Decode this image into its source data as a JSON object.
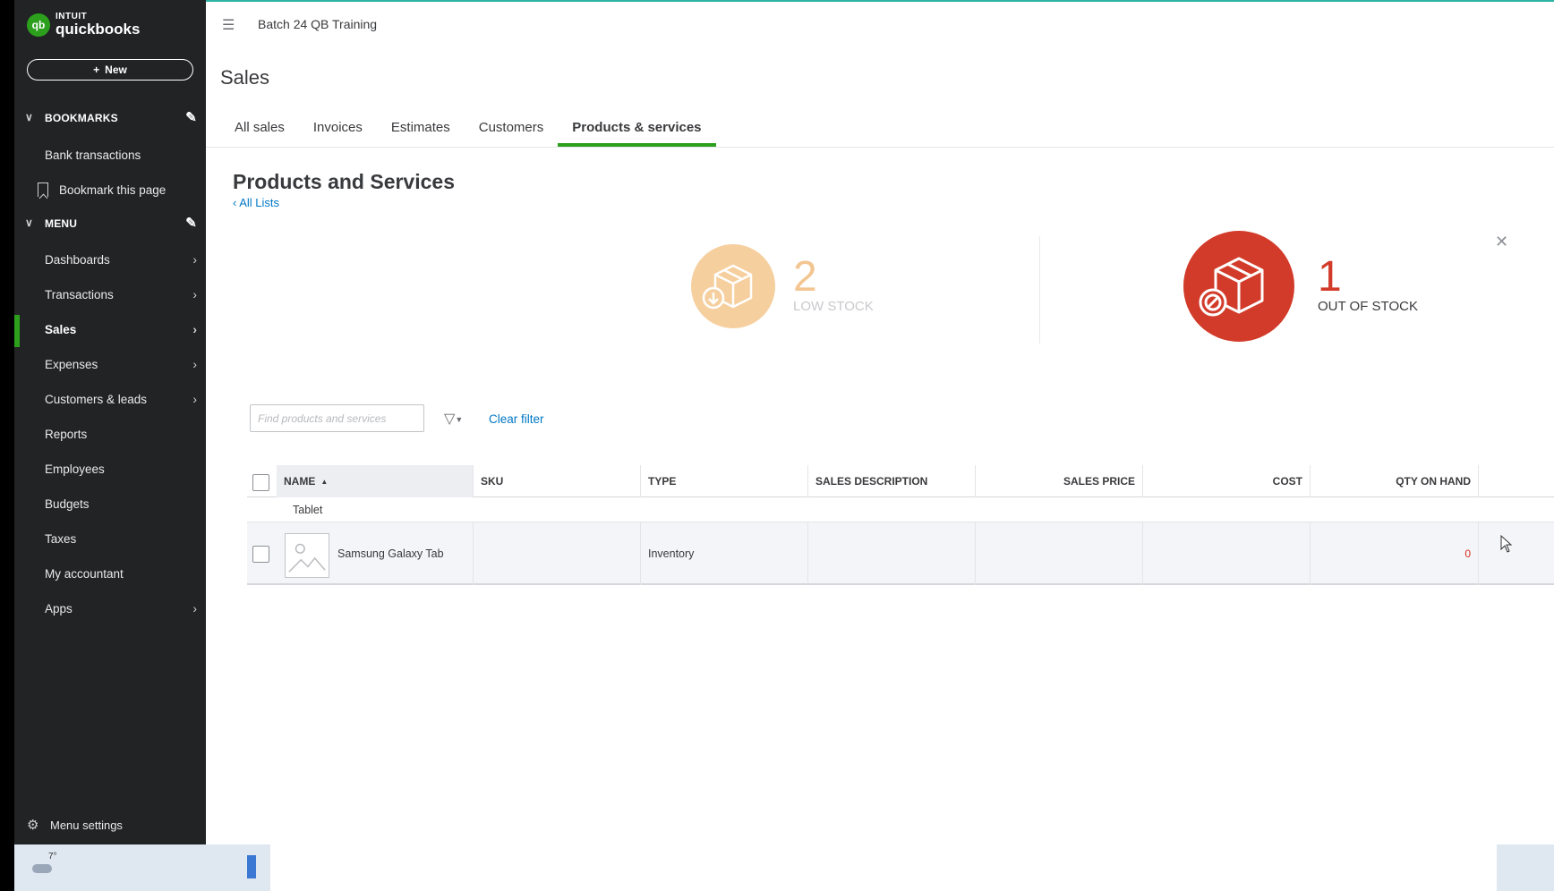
{
  "sidebar": {
    "logo_brand": "intuit",
    "logo_product": "quickbooks",
    "new_button": "New",
    "bookmarks_heading": "BOOKMARKS",
    "bookmark_items": [
      "Bank transactions",
      "Bookmark this page"
    ],
    "menu_heading": "MENU",
    "menu_items": [
      {
        "label": "Dashboards",
        "has_arrow": true
      },
      {
        "label": "Transactions",
        "has_arrow": true
      },
      {
        "label": "Sales",
        "has_arrow": true,
        "active": true
      },
      {
        "label": "Expenses",
        "has_arrow": true
      },
      {
        "label": "Customers & leads",
        "has_arrow": true
      },
      {
        "label": "Reports",
        "has_arrow": false
      },
      {
        "label": "Employees",
        "has_arrow": false
      },
      {
        "label": "Budgets",
        "has_arrow": false
      },
      {
        "label": "Taxes",
        "has_arrow": false
      },
      {
        "label": "My accountant",
        "has_arrow": false
      },
      {
        "label": "Apps",
        "has_arrow": true
      }
    ],
    "menu_settings": "Menu settings"
  },
  "header": {
    "company": "Batch 24 QB Training",
    "page_title": "Sales"
  },
  "tabs": [
    {
      "label": "All sales"
    },
    {
      "label": "Invoices"
    },
    {
      "label": "Estimates"
    },
    {
      "label": "Customers"
    },
    {
      "label": "Products & services",
      "active": true
    }
  ],
  "content": {
    "title": "Products and Services",
    "all_lists": "All Lists",
    "low_stock_count": "2",
    "low_stock_label": "LOW STOCK",
    "out_stock_count": "1",
    "out_stock_label": "OUT OF STOCK",
    "search_placeholder": "Find products and services",
    "clear_filter": "Clear filter"
  },
  "table": {
    "columns": {
      "name": "NAME",
      "sku": "SKU",
      "type": "TYPE",
      "sales_description": "SALES DESCRIPTION",
      "sales_price": "SALES PRICE",
      "cost": "COST",
      "qty_on_hand": "QTY ON HAND"
    },
    "group": "Tablet",
    "rows": [
      {
        "name": "Samsung Galaxy Tab",
        "sku": "",
        "type": "Inventory",
        "sales_description": "",
        "sales_price": "",
        "cost": "",
        "qty_on_hand": "0"
      }
    ]
  },
  "taskbar": {
    "temperature": "7°"
  },
  "colors": {
    "sidebar_bg": "#212325",
    "accent_green": "#2ca01c",
    "link_blue": "#0077c5",
    "low_stock": "#f6cf9e",
    "out_of_stock": "#d23b2a"
  }
}
